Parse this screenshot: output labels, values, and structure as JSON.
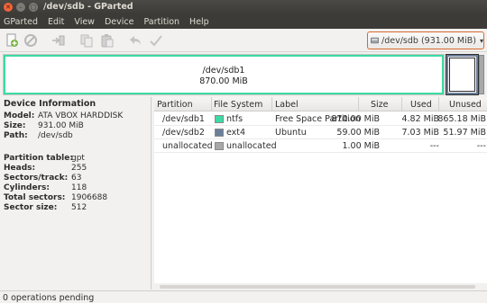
{
  "window": {
    "title": "/dev/sdb - GParted"
  },
  "menu": [
    "GParted",
    "Edit",
    "View",
    "Device",
    "Partition",
    "Help"
  ],
  "toolbar": {
    "icons": [
      "new-partition-icon",
      "delete-partition-icon",
      "resize-move-icon",
      "copy-icon",
      "paste-icon",
      "undo-icon",
      "apply-icon"
    ]
  },
  "device_selector": {
    "value": "/dev/sdb  (931.00 MiB)"
  },
  "disk_map": {
    "partition_name": "/dev/sdb1",
    "partition_size": "870.00 MiB",
    "colors": {
      "ntfs": "#3ddba4",
      "ext4": "#6a7f9a",
      "unallocated": "#a8a8a8"
    }
  },
  "device_info": {
    "header": "Device Information",
    "model_label": "Model:",
    "model": "ATA VBOX HARDDISK",
    "size_label": "Size:",
    "size": "931.00 MiB",
    "path_label": "Path:",
    "path": "/dev/sdb",
    "partition_table_label": "Partition table:",
    "partition_table": "gpt",
    "heads_label": "Heads:",
    "heads": "255",
    "sectors_track_label": "Sectors/track:",
    "sectors_track": "63",
    "cylinders_label": "Cylinders:",
    "cylinders": "118",
    "total_sectors_label": "Total sectors:",
    "total_sectors": "1906688",
    "sector_size_label": "Sector size:",
    "sector_size": "512"
  },
  "table": {
    "headers": {
      "partition": "Partition",
      "filesystem": "File System",
      "label": "Label",
      "size": "Size",
      "used": "Used",
      "unused": "Unused"
    },
    "rows": [
      {
        "partition": "/dev/sdb1",
        "filesystem": "ntfs",
        "fs_color": "#3ddba4",
        "label": "Free Space Partition",
        "size": "870.00 MiB",
        "used": "4.82 MiB",
        "unused": "865.18 MiB"
      },
      {
        "partition": "/dev/sdb2",
        "filesystem": "ext4",
        "fs_color": "#6a7f9a",
        "label": "Ubuntu",
        "size": "59.00 MiB",
        "used": "7.03 MiB",
        "unused": "51.97 MiB"
      },
      {
        "partition": "unallocated",
        "filesystem": "unallocated",
        "fs_color": "#a8a8a8",
        "label": "",
        "size": "1.00 MiB",
        "used": "---",
        "unused": "---"
      }
    ]
  },
  "status": {
    "text": "0 operations pending"
  }
}
